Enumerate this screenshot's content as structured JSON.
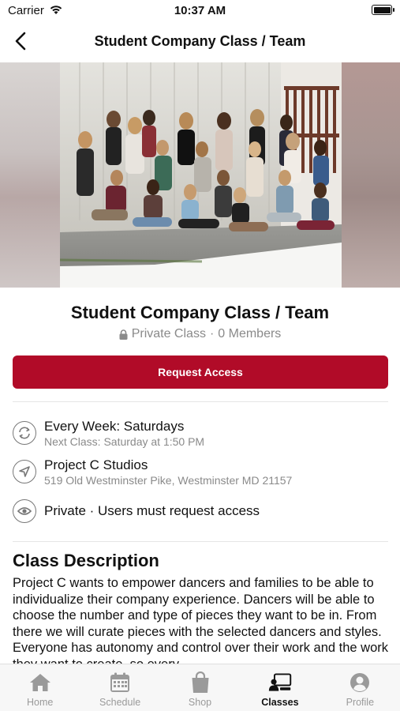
{
  "status_bar": {
    "carrier": "Carrier",
    "time": "10:37 AM"
  },
  "nav": {
    "title": "Student Company Class / Team"
  },
  "class": {
    "title": "Student Company Class / Team",
    "privacy": "Private Class",
    "members": "0 Members",
    "request_label": "Request Access"
  },
  "schedule": {
    "title": "Every Week: Saturdays",
    "next_class": "Next Class: Saturday at 1:50 PM"
  },
  "location": {
    "name": "Project C Studios",
    "address": "519 Old Westminster Pike, Westminster MD 21157"
  },
  "visibility": {
    "text": "Private · Users must request access"
  },
  "description": {
    "heading": "Class Description",
    "body": "Project C wants to empower dancers and families to be able to individualize their company experience. Dancers will be able to choose the number and type of pieces they want to be in. From there we will curate pieces with the selected dancers and styles. Everyone has autonomy and control over their work and the work they want to create, so every"
  },
  "tabs": [
    {
      "label": "Home",
      "icon": "home-icon"
    },
    {
      "label": "Schedule",
      "icon": "calendar-icon"
    },
    {
      "label": "Shop",
      "icon": "shopping-bag-icon"
    },
    {
      "label": "Classes",
      "icon": "classes-icon",
      "active": true
    },
    {
      "label": "Profile",
      "icon": "profile-icon"
    }
  ],
  "colors": {
    "accent": "#b10b28",
    "muted_text": "#8a8a8a",
    "tab_inactive": "#9a9a9a"
  }
}
